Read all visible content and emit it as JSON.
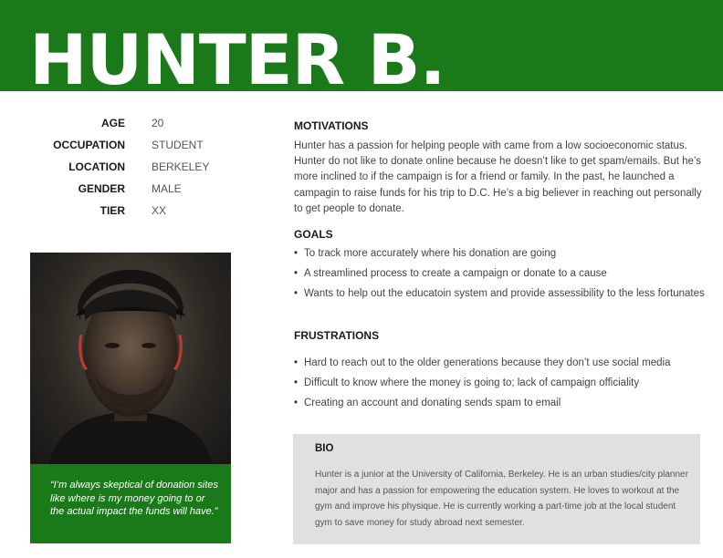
{
  "persona": {
    "name": "HUNTER B.",
    "facts": [
      {
        "label": "AGE",
        "value": "20"
      },
      {
        "label": "OCCUPATION",
        "value": "STUDENT"
      },
      {
        "label": "LOCATION",
        "value": "BERKELEY"
      },
      {
        "label": "GENDER",
        "value": "MALE"
      },
      {
        "label": "TIER",
        "value": "XX"
      }
    ],
    "quote": "“I’m always skeptical of donation sites like where is my money going to or the actual impact the funds will have.”"
  },
  "motivations": {
    "title": "MOTIVATIONS",
    "text": "Hunter has a passion for helping people with came from a low socioeconomic status. Hunter do not like to donate online because he doesn’t like to get spam/emails. But he’s more inclined to if the campaign is for a friend or family. In the past, he launched a campagin to raise funds for his trip to D.C. He’s a big believer in reaching out personally to get people to donate."
  },
  "goals": {
    "title": "GOALS",
    "items": [
      "To track more accurately where his donation are going",
      "A streamlined process to create a campaign or donate to a cause",
      "Wants to help out the educatoin system and provide assessibility to the less fortunates"
    ]
  },
  "frustrations": {
    "title": "FRUSTRATIONS",
    "items": [
      "Hard to reach out to the older generations because they don’t use social media",
      "Difficult to know where the money is going to; lack of campaign officiality",
      "Creating an account and donating sends spam to email"
    ]
  },
  "bio": {
    "title": "BIO",
    "text": "Hunter is a junior at the University of California, Berkeley. He is an urban studies/city planner major and has a passion for empowering the education system. He loves to workout at the gym and improve his physique. He is currently working a part-time job at the local student gym to save money for study abroad next semester."
  },
  "colors": {
    "accent": "#1a7a1a",
    "bio_bg": "#e0e0e0"
  }
}
